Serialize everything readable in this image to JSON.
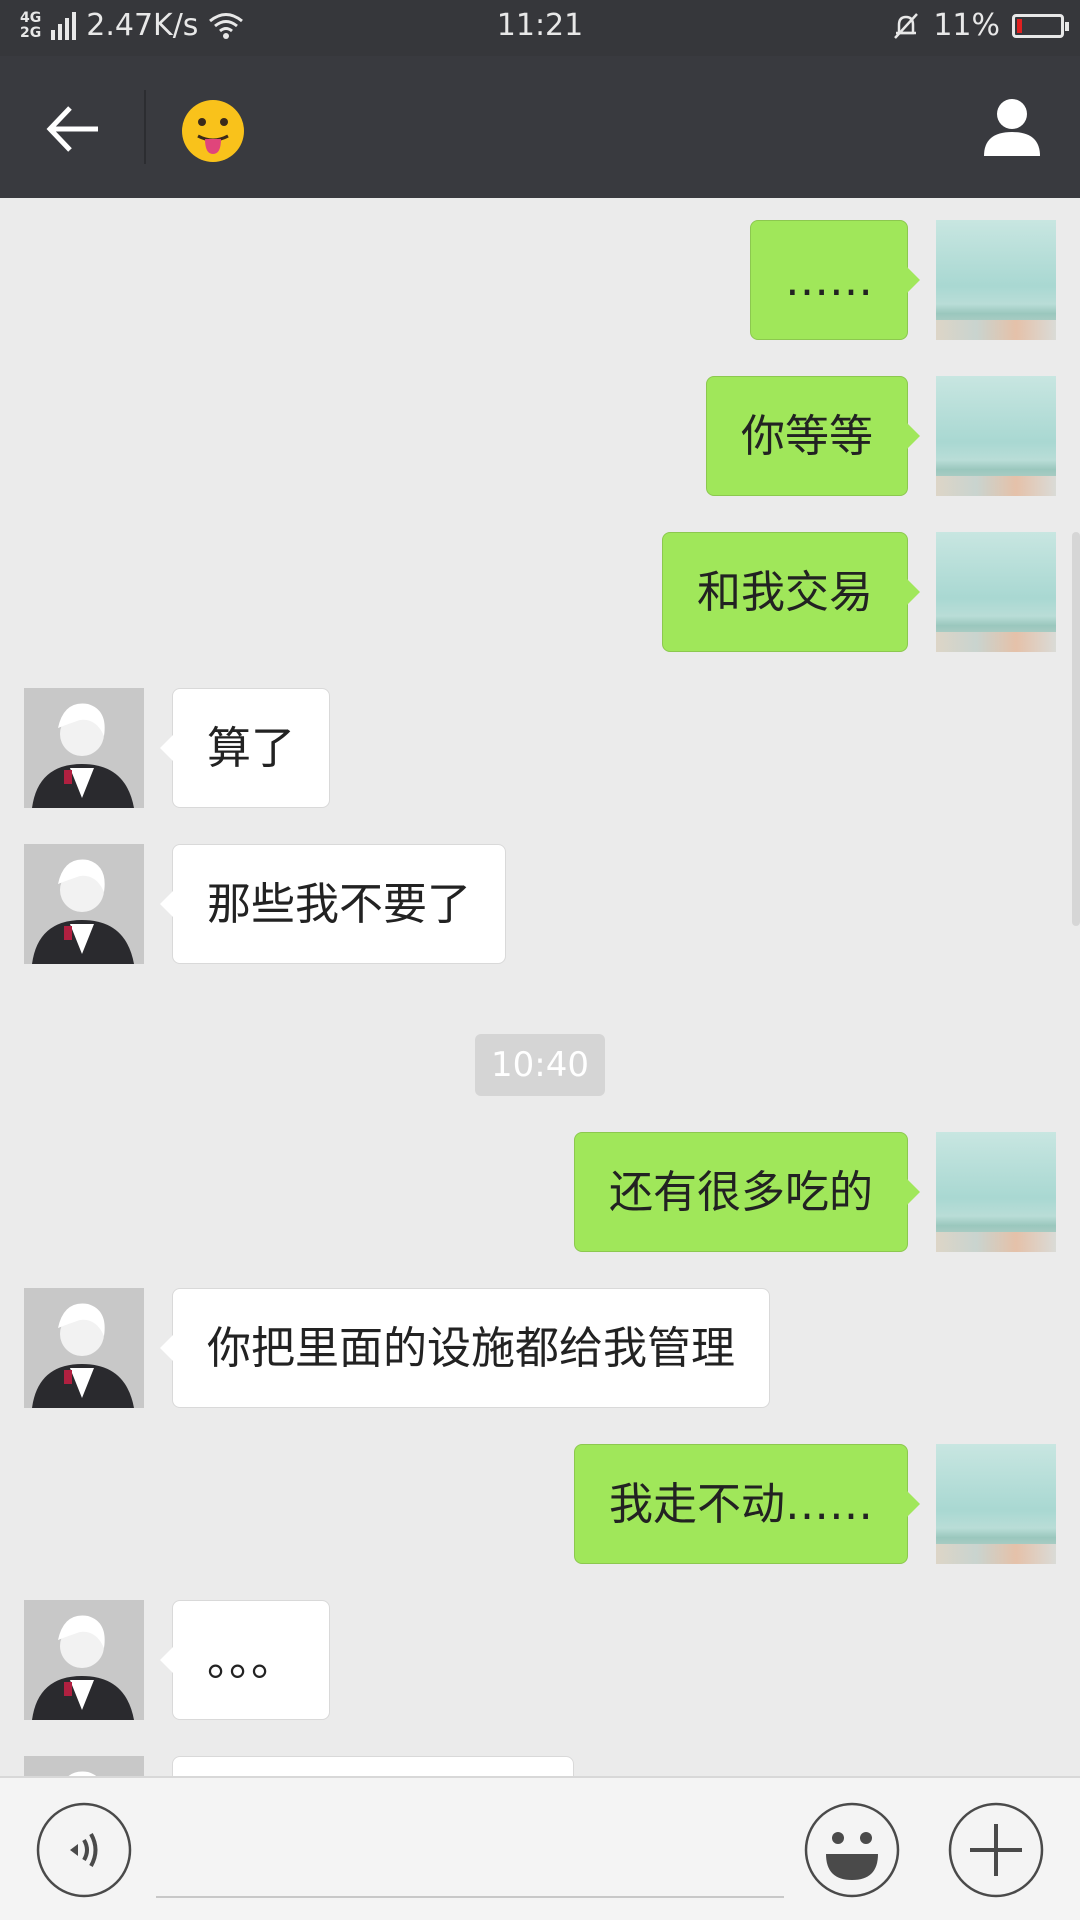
{
  "status_bar": {
    "network": "4G 2G",
    "speed": "2.47K/s",
    "time": "11:21",
    "battery_percent": "11%",
    "battery_level": 0.11
  },
  "header": {
    "title_emoji": "😛"
  },
  "messages": [
    {
      "side": "self",
      "text": "……"
    },
    {
      "side": "self",
      "text": "你等等"
    },
    {
      "side": "self",
      "text": "和我交易"
    },
    {
      "side": "other",
      "text": "算了"
    },
    {
      "side": "other",
      "text": "那些我不要了"
    },
    {
      "side": "self",
      "text": "还有很多吃的"
    },
    {
      "side": "other",
      "text": "你把里面的设施都给我管理"
    },
    {
      "side": "self",
      "text": "我走不动……"
    },
    {
      "side": "other",
      "text": "。。。"
    },
    {
      "side": "other",
      "text": ""
    }
  ],
  "timestamp": "10:40",
  "input": {
    "value": "",
    "placeholder": ""
  },
  "colors": {
    "header_bg": "#393a3f",
    "self_bubble": "#a0e75a",
    "other_bubble": "#ffffff",
    "chat_bg": "#ebebeb"
  }
}
